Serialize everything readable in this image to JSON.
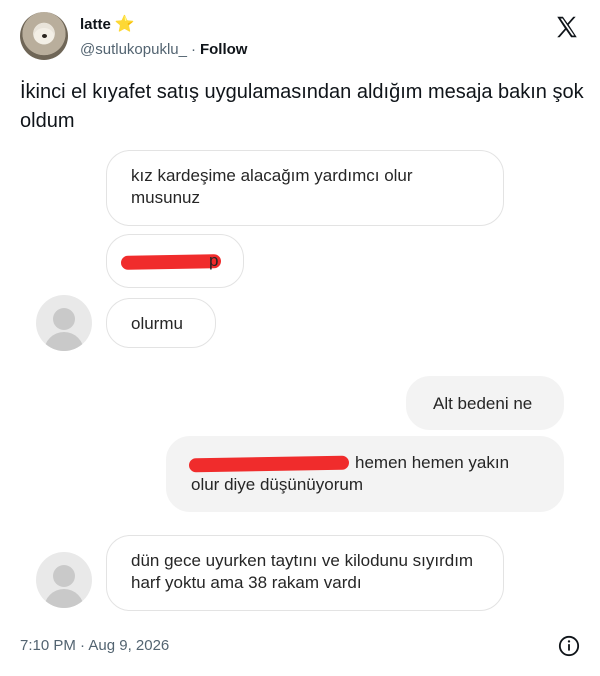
{
  "tweet": {
    "display_name": "latte",
    "verified_emoji": "⭐",
    "handle": "@sutlukopuklu_",
    "separator": "·",
    "follow_label": "Follow",
    "text": "İkinci el kıyafet satış uygulamasından aldığım mesaja bakın şok oldum",
    "timestamp": "7:10 PM · Aug 9, 2026"
  },
  "chat": {
    "messages": [
      {
        "side": "incoming",
        "text": "kız kardeşime alacağım yardımcı olur musunuz"
      },
      {
        "side": "incoming",
        "text": "p",
        "redacted_prefix": true
      },
      {
        "side": "incoming",
        "text": "olurmu"
      },
      {
        "side": "outgoing",
        "text": "Alt bedeni ne"
      },
      {
        "side": "outgoing",
        "text": "hemen hemen yakın olur diye düşünüyorum",
        "redacted_prefix": true
      },
      {
        "side": "incoming",
        "text": "dün gece uyurken taytını ve kilodunu sıyırdım  harf yoktu ama 38 rakam vardı"
      }
    ]
  },
  "colors": {
    "redaction": "#f02c2c",
    "follow": "#0f1419",
    "star": "#f5c518"
  },
  "icons": {
    "brand": "x-logo-icon",
    "info": "info-icon",
    "avatar_placeholder": "person-placeholder-icon"
  }
}
